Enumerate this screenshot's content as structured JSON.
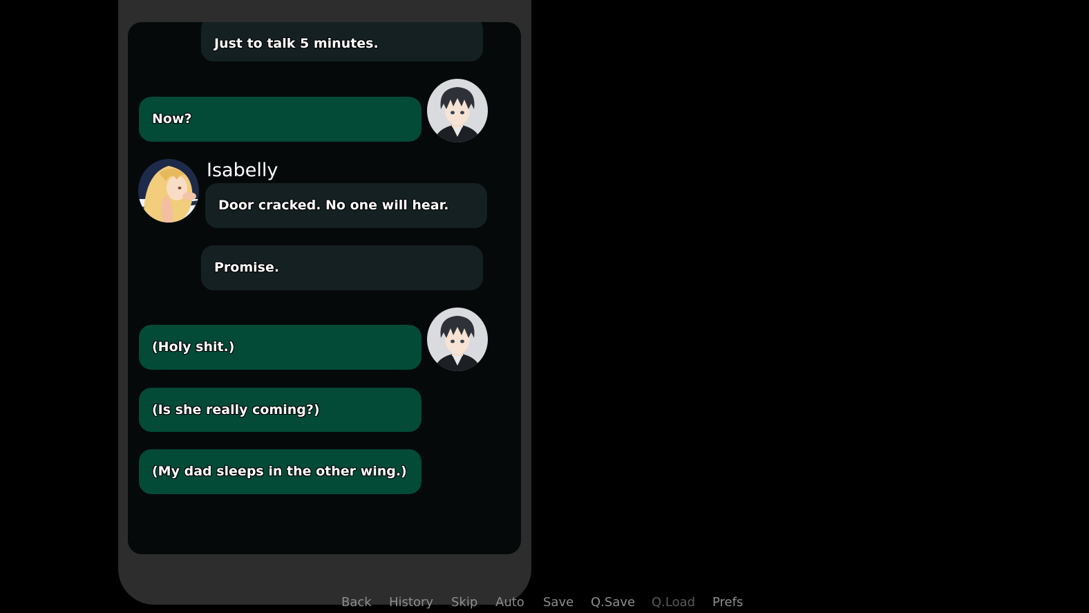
{
  "chat": {
    "messages": [
      {
        "text": "Just to talk 5 minutes."
      },
      {
        "text": "Now?"
      },
      {
        "sender": "Isabelly",
        "text": "Door cracked. No one will hear."
      },
      {
        "text": "Promise."
      },
      {
        "text": "(Holy shit.)"
      },
      {
        "text": "(Is she really coming?)"
      },
      {
        "text": "(My dad sleeps in the other wing.)"
      }
    ]
  },
  "quick_menu": [
    {
      "label": "Back",
      "enabled": true
    },
    {
      "label": "History",
      "enabled": true
    },
    {
      "label": "Skip",
      "enabled": true
    },
    {
      "label": "Auto",
      "enabled": true
    },
    {
      "label": "Save",
      "enabled": true
    },
    {
      "label": "Q.Save",
      "enabled": true
    },
    {
      "label": "Q.Load",
      "enabled": false
    },
    {
      "label": "Prefs",
      "enabled": true
    }
  ],
  "colors": {
    "incoming_bubble": "#152022",
    "outgoing_bubble": "#034a37",
    "phone_frame": "#2d2d2d",
    "screen": "#05090a",
    "menu_text": "#8f8f8f",
    "menu_text_disabled": "#5a5a5a"
  },
  "icons": [
    "player-avatar-icon",
    "isabelly-avatar-icon"
  ]
}
